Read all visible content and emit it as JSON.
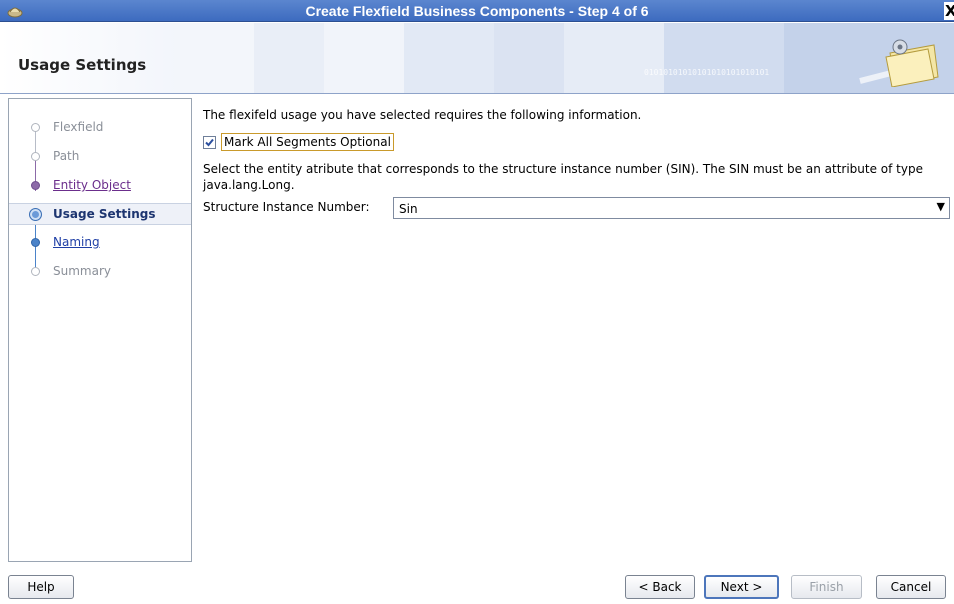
{
  "window": {
    "title": "Create Flexfield Business Components - Step 4 of 6",
    "close_label": "X"
  },
  "header": {
    "title": "Usage Settings"
  },
  "nav": {
    "items": [
      {
        "label": "Flexfield",
        "state": "visited-grey"
      },
      {
        "label": "Path",
        "state": "visited-grey"
      },
      {
        "label": "Entity Object",
        "state": "visited-link"
      },
      {
        "label": "Usage Settings",
        "state": "current"
      },
      {
        "label": "Naming",
        "state": "next-link"
      },
      {
        "label": "Summary",
        "state": "pending"
      }
    ]
  },
  "content": {
    "intro": "The flexifeld usage you have selected requires the following information.",
    "checkbox_label": "Mark All Segments Optional",
    "checkbox_checked": true,
    "description": "Select the entity atribute that corresponds to the structure instance number (SIN). The SIN must be an attribute of type java.lang.Long.",
    "sin_label": "Structure Instance Number:",
    "sin_value": "Sin"
  },
  "footer": {
    "help": "Help",
    "back": "< Back",
    "next": "Next >",
    "finish": "Finish",
    "cancel": "Cancel"
  },
  "colors": {
    "titlebar": "#4a78c6",
    "link_visited": "#6b2e8c",
    "link": "#1f3fa6",
    "current_step": "#1d3570"
  }
}
